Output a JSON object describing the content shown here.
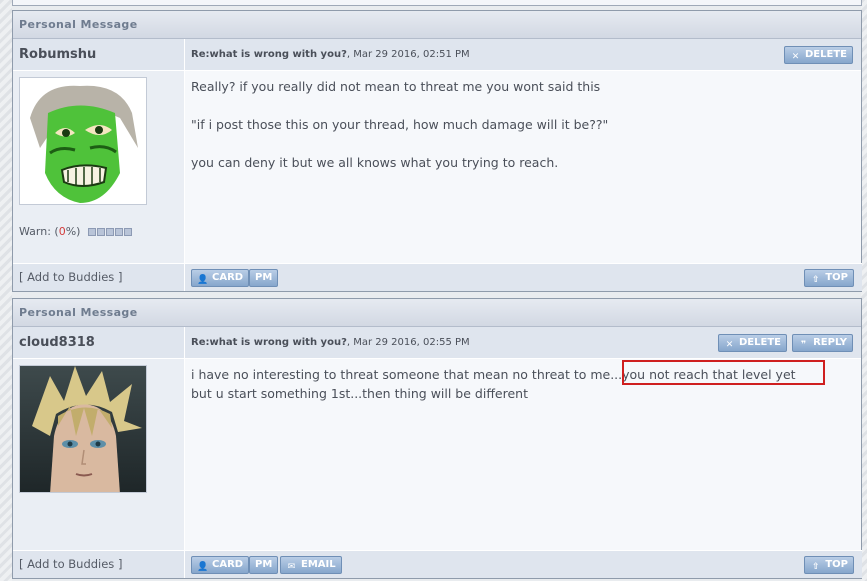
{
  "colors": {
    "header_text": "#6f7c8f",
    "button_blue": "#86a6cc",
    "highlight_red": "#cf1f1f",
    "warn_percent": "#d23c3c"
  },
  "messages": [
    {
      "header": "Personal Message",
      "author": "Robumshu",
      "subject": "Re:what is wrong with you?",
      "date": ", Mar 29 2016, 02:51 PM",
      "avatar_icon": "green-face-paint-avatar",
      "warn_label": "Warn: (",
      "warn_percent": "0",
      "warn_suffix": "%)",
      "lines": [
        "Really? if you really did not mean to threat me you wont said this",
        "\"if i post those this on your thread, how much damage will it be??\"",
        "you can deny it but we all knows what you trying to reach."
      ],
      "buttons": {
        "delete": "DELETE",
        "card": "CARD",
        "pm": "PM",
        "top": "TOP"
      },
      "add_buddies": "[ Add to Buddies ]"
    },
    {
      "header": "Personal Message",
      "author": "cloud8318",
      "subject": "Re:what is wrong with you?",
      "date": ", Mar 29 2016, 02:55 PM",
      "avatar_icon": "cloud-strife-avatar",
      "lines": [
        "i have no interesting to threat someone that mean no threat to me...you not reach that level yet",
        "but u start something 1st...then thing will be different"
      ],
      "buttons": {
        "delete": "DELETE",
        "reply": "REPLY",
        "card": "CARD",
        "pm": "PM",
        "email": "EMAIL",
        "top": "TOP"
      },
      "add_buddies": "[ Add to Buddies ]"
    }
  ]
}
